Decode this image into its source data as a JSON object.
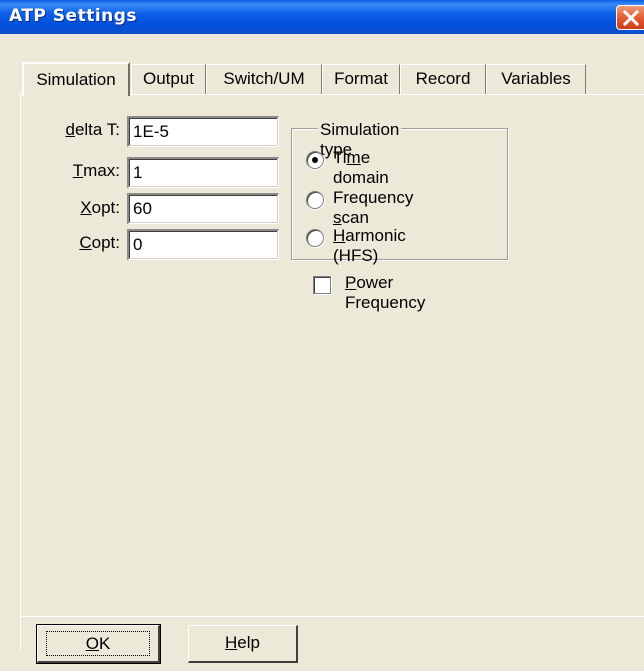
{
  "window": {
    "title": "ATP Settings",
    "close_icon": "close-icon"
  },
  "tabs": [
    {
      "label": "Simulation",
      "active": true
    },
    {
      "label": "Output",
      "active": false
    },
    {
      "label": "Switch/UM",
      "active": false
    },
    {
      "label": "Format",
      "active": false
    },
    {
      "label": "Record",
      "active": false
    },
    {
      "label": "Variables",
      "active": false
    }
  ],
  "fields": [
    {
      "label_pre": "",
      "label_mnemonic": "d",
      "label_post": "elta T:",
      "value": "1E-5"
    },
    {
      "label_pre": "",
      "label_mnemonic": "T",
      "label_post": "max:",
      "value": "1"
    },
    {
      "label_pre": "",
      "label_mnemonic": "X",
      "label_post": "opt:",
      "value": "60"
    },
    {
      "label_pre": "",
      "label_mnemonic": "C",
      "label_post": "opt:",
      "value": "0"
    }
  ],
  "simulation_type": {
    "legend": "Simulation type",
    "options": [
      {
        "pre": "Ti",
        "mnemonic": "m",
        "post": "e domain",
        "selected": true
      },
      {
        "pre": "Frequency ",
        "mnemonic": "s",
        "post": "can",
        "selected": false
      },
      {
        "pre": "",
        "mnemonic": "H",
        "post": "armonic (HFS)",
        "selected": false
      }
    ]
  },
  "power_frequency": {
    "pre": "",
    "mnemonic": "P",
    "post": "ower Frequency",
    "checked": false
  },
  "buttons": {
    "ok": {
      "mnemonic": "O",
      "post": "K"
    },
    "help": {
      "mnemonic": "H",
      "post": "elp"
    }
  },
  "colors": {
    "titlebar": "#0350dc",
    "face": "#ece9d8",
    "close": "#e2532c"
  }
}
